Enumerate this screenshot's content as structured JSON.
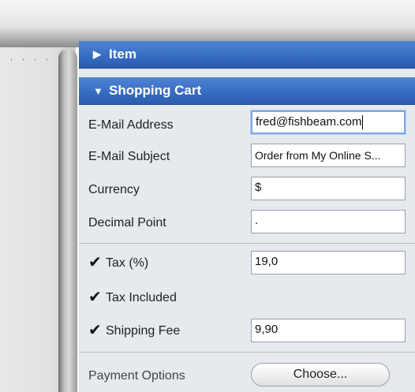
{
  "item_header": {
    "label": "Item",
    "icon": "disclosure-right-icon"
  },
  "cart_header": {
    "label": "Shopping Cart",
    "icon": "disclosure-down-icon"
  },
  "fields": {
    "email_label": "E-Mail Address",
    "email_value": "fred@fishbeam.com",
    "subject_label": "E-Mail Subject",
    "subject_value": "Order from My Online S...",
    "currency_label": "Currency",
    "currency_value": "$",
    "decimal_label": "Decimal Point",
    "decimal_value": "."
  },
  "options": {
    "tax_label": "Tax (%)",
    "tax_checked": true,
    "tax_value": "19,0",
    "tax_included_label": "Tax Included",
    "tax_included_checked": true,
    "shipping_label": "Shipping Fee",
    "shipping_checked": true,
    "shipping_value": "9,90"
  },
  "payment": {
    "label": "Payment Options",
    "button_label": "Choose..."
  },
  "colors": {
    "header_blue": "#3b6fc3",
    "panel_bg": "#e6e9ee"
  }
}
